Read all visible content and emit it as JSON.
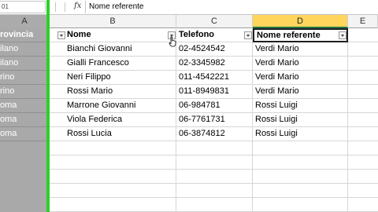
{
  "formula_bar": {
    "name_box": "01",
    "fx_label": "fx",
    "content": "Nome referente"
  },
  "columns": [
    {
      "label": "A"
    },
    {
      "label": "B"
    },
    {
      "label": "C"
    },
    {
      "label": "D"
    },
    {
      "label": "E"
    }
  ],
  "gutter_rows": [
    "rovincia",
    "ilano",
    "ilano",
    "rino",
    "rino",
    "oma",
    "oma",
    "oma"
  ],
  "table": {
    "headers": [
      "Nome",
      "Telefono",
      "Nome referente"
    ],
    "rows": [
      [
        "Bianchi Giovanni",
        "02-4524542",
        "Verdi Mario"
      ],
      [
        "Gialli Francesco",
        "02-3345982",
        "Verdi Mario"
      ],
      [
        "Neri Filippo",
        "011-4542221",
        "Verdi Mario"
      ],
      [
        "Rossi Mario",
        "011-8949831",
        "Verdi Mario"
      ],
      [
        "Marrone Giovanni",
        "06-984781",
        "Rossi Luigi"
      ],
      [
        "Viola Federica",
        "06-7761731",
        "Rossi Luigi"
      ],
      [
        "Rossi Lucia",
        "06-3874812",
        "Rossi Luigi"
      ]
    ]
  },
  "colors": {
    "selected_header": "#ffd55c",
    "gutter": "#a9a9a9",
    "green_divider": "#2bd12b"
  },
  "icons": {
    "filter": "dropdown-triangle",
    "cursor": "mouse-pointer"
  }
}
